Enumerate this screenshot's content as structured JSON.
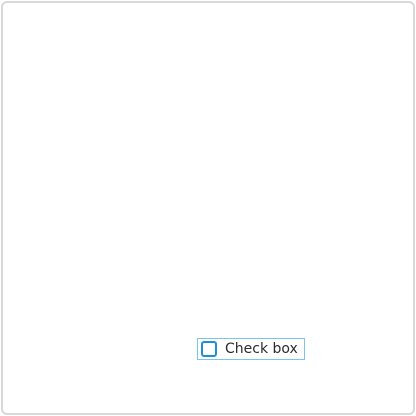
{
  "window": {
    "border_color": "#d9d9d9",
    "background": "#ffffff"
  },
  "checkbox": {
    "label": "Check box",
    "checked": false,
    "focused": true,
    "box_color": "#1e8fd6",
    "focus_ring_color": "#7cc3ef"
  }
}
